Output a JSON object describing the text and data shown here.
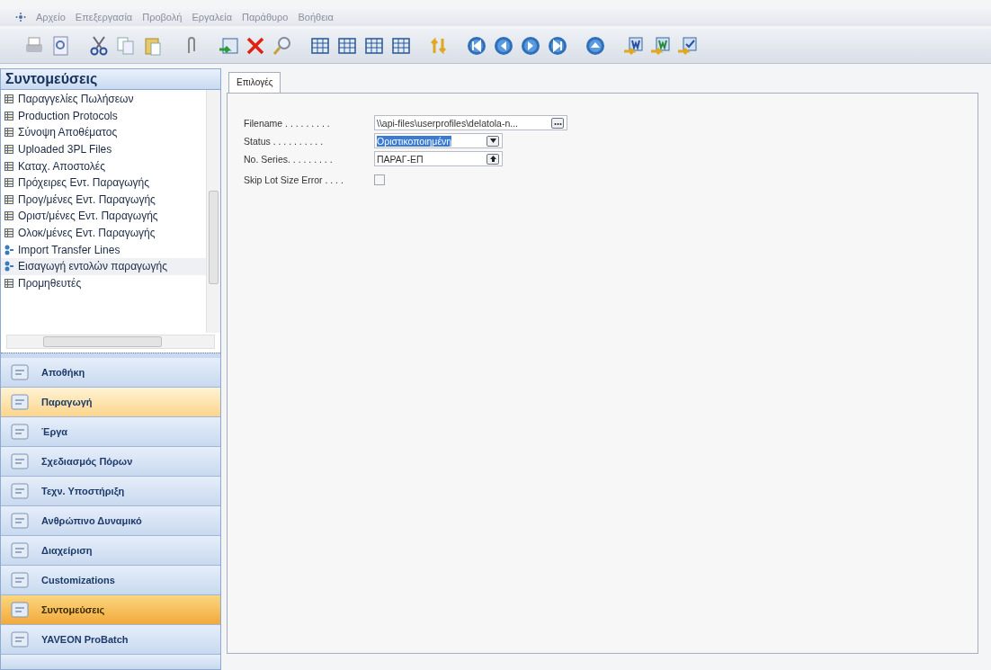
{
  "menu": [
    "Αρχείο",
    "Επεξεργασία",
    "Προβολή",
    "Εργαλεία",
    "Παράθυρο",
    "Βοήθεια"
  ],
  "shortcuts": {
    "title": "Συντομεύσεις",
    "items": [
      {
        "label": "Παραγγελίες Πωλήσεων",
        "kind": "table",
        "selected": false
      },
      {
        "label": "Production Protocols",
        "kind": "table",
        "selected": false
      },
      {
        "label": "Σύνοψη Αποθέματος",
        "kind": "table",
        "selected": false
      },
      {
        "label": "Uploaded 3PL Files",
        "kind": "table",
        "selected": false
      },
      {
        "label": "Καταχ. Αποστολές",
        "kind": "table",
        "selected": false
      },
      {
        "label": "Πρόχειρες Εντ. Παραγωγής",
        "kind": "table",
        "selected": false
      },
      {
        "label": "Προγ/μένες Εντ. Παραγωγής",
        "kind": "table",
        "selected": false
      },
      {
        "label": "Οριστ/μένες Εντ. Παραγωγής",
        "kind": "table",
        "selected": false
      },
      {
        "label": "Ολοκ/μένες Εντ. Παραγωγής",
        "kind": "table",
        "selected": false
      },
      {
        "label": "Import Transfer Lines",
        "kind": "import",
        "selected": false
      },
      {
        "label": "Εισαγωγή εντολών παραγωγής",
        "kind": "import",
        "selected": true
      },
      {
        "label": "Προμηθευτές",
        "kind": "table",
        "selected": false
      }
    ]
  },
  "nav": [
    {
      "label": "Αποθήκη",
      "selected": false,
      "hover": false
    },
    {
      "label": "Παραγωγή",
      "selected": false,
      "hover": true
    },
    {
      "label": "Έργα",
      "selected": false,
      "hover": false
    },
    {
      "label": "Σχεδιασμός Πόρων",
      "selected": false,
      "hover": false
    },
    {
      "label": "Τεχν. Υποστήριξη",
      "selected": false,
      "hover": false
    },
    {
      "label": "Ανθρώπινο Δυναμικό",
      "selected": false,
      "hover": false
    },
    {
      "label": "Διαχείριση",
      "selected": false,
      "hover": false
    },
    {
      "label": "Customizations",
      "selected": false,
      "hover": false
    },
    {
      "label": "Συντομεύσεις",
      "selected": true,
      "hover": false
    },
    {
      "label": "YAVEON ProBatch",
      "selected": false,
      "hover": false
    }
  ],
  "tabs": [
    {
      "label": "Επιλογές",
      "selected": true
    }
  ],
  "fields": [
    {
      "kind": "file",
      "label": "Filename . . . . . . . . .",
      "value": "\\\\api-files\\userprofiles\\delatola-n..."
    },
    {
      "kind": "dropdown",
      "label": "Status . . . . . . . . . .",
      "value": "Οριστικοποιημένη",
      "text_selected": true
    },
    {
      "kind": "lookup",
      "label": "No. Series. . . . . . . . .",
      "value": "ΠΑΡΑΓ-ΕΠ",
      "text_selected": false
    },
    {
      "kind": "checkbox",
      "label": "Skip Lot Size Error . . . .",
      "checked": false
    }
  ]
}
